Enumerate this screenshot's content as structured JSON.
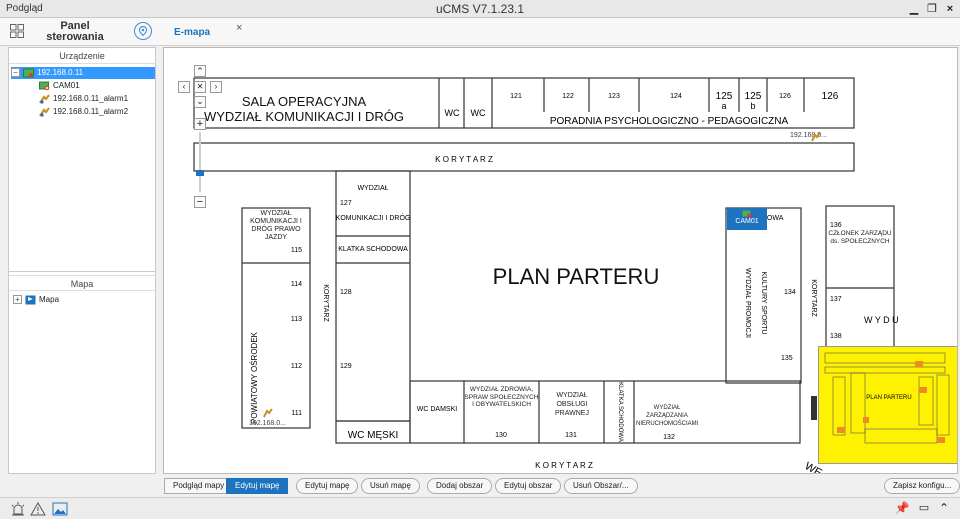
{
  "window": {
    "title": "Podgląd",
    "app_title": "uCMS V7.1.23.1"
  },
  "topbar": {
    "panel_label": "Panel sterowania",
    "tab_label": "E-mapa",
    "tab_close": "×"
  },
  "left_panel": {
    "device_header": "Urządzenie",
    "device_tree": {
      "root": "192.168.0.11",
      "children": [
        "CAM01",
        "192.168.0.11_alarm1",
        "192.168.0.11_alarm2"
      ]
    },
    "map_header": "Mapa",
    "map_tree": {
      "root": "Mapa"
    }
  },
  "map": {
    "title_main": "PLAN PARTERU",
    "top_left_title_line1": "SALA OPERACYJNA",
    "top_left_title_line2": "WYDZIAŁ KOMUNIKACJI I DRÓG",
    "wc1": "WC",
    "wc2": "WC",
    "room121": "121",
    "room122": "122",
    "room123": "123",
    "room124": "124",
    "room125a": "125",
    "room125a_sub": "a",
    "room125b": "125",
    "room125b_sub": "b",
    "room126a": "126",
    "room126b": "126",
    "poradnia": "PORADNIA PSYCHOLOGICZNO - PEDAGOGICZNA",
    "korytarz_top": "K O R Y T A R Z",
    "korytarz_bottom": "K O R Y T A R Z",
    "korytarz_left": "KORYTARZ",
    "korytarz_right": "KORYTARZ",
    "wydzial_prawo": "WYDZIAŁ KOMUNIKACJI I DRÓG PRAWO JAZDY",
    "room115": "115",
    "room114": "114",
    "room113": "113",
    "room112": "112",
    "room111": "111",
    "powiatowy_osrodek": "POWIATOWY OŚRODEK",
    "wydzial_komunikacji_127": "WYDZIAŁ",
    "room127": "127",
    "komunikacji_drog": "KOMUNIKACJI I DRÓG",
    "klatka": "KLATKA SCHODOWA",
    "room128": "128",
    "room129": "129",
    "wc_meski": "WC MĘSKI",
    "wc_damski": "WC DAMSKI",
    "wydzial_zdrowia": "WYDZIAŁ ZDROWIA, SPRAW SPOŁECZNYCH I OBYWATELSKICH",
    "room130": "130",
    "wydzial_obslugi": "WYDZIAŁ OBSŁUGI PRAWNEJ",
    "room131": "131",
    "klatka_schodowa_v": "KLATKA SCHODOWA",
    "wydzial_zarzadzania": "WYDZIAŁ ZARZĄDZANIA NIERUCHOMOŚCIAMI",
    "room132": "132",
    "cam_label": "CAM01",
    "ka_owa": "KA OWA",
    "wydzial_promocji": "WYDZIAŁ PROMOCJI",
    "kultury_sportu": "KULTURY SPORTU",
    "room134": "134",
    "room135": "135",
    "room136": "136",
    "czlonek_zarzadu": "CZŁONEK ZARZĄDU ds. SPOŁECZNYCH",
    "room137": "137",
    "room138": "138",
    "wydu": "W Y D U",
    "we": "WE",
    "alarm_ip_1": "192.168.0...",
    "alarm_ip_2": "192.168.0..."
  },
  "minimap": {
    "label": "PLAN PARTERU"
  },
  "toolbar": {
    "podglad_mapy": "Podgląd mapy",
    "edytuj_mape_active": "Edytuj mapę",
    "edytuj_mape": "Edytuj mapę",
    "usun_mape": "Usuń mapę",
    "dodaj_obszar": "Dodaj obszar",
    "edytuj_obszar": "Edytuj obszar",
    "usun_obszar": "Usuń Obszar/...",
    "zapisz_konfig": "Zapisz konfigu..."
  },
  "colors": {
    "accent": "#1e73be",
    "selection": "#3399ff",
    "minimap_bg": "#fff200"
  }
}
